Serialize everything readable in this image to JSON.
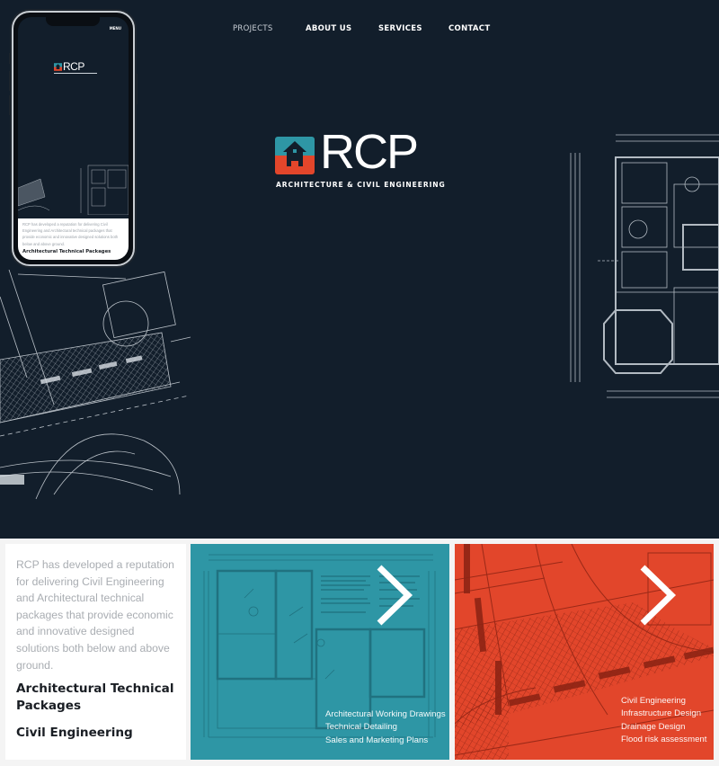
{
  "nav": {
    "items": [
      {
        "label": "PROJECTS",
        "active": true
      },
      {
        "label": "ABOUT US",
        "active": false
      },
      {
        "label": "SERVICES",
        "active": false
      },
      {
        "label": "CONTACT",
        "active": false
      }
    ]
  },
  "brand": {
    "name": "RCP",
    "tagline": "ARCHITECTURE & CIVIL ENGINEERING",
    "colors": {
      "navy": "#121e2b",
      "teal": "#2e96a5",
      "red": "#e2462b"
    },
    "logo_icon": "house-icon"
  },
  "phone_preview": {
    "menu_label": "MENU",
    "logo_text": "RCP",
    "intro": "RCP has developed a reputation for delivering Civil Engineering and Architectural technical packages that provide economic and innovative designed solutions both below and above ground.",
    "heading": "Architectural Technical Packages"
  },
  "intro": {
    "text": "RCP has developed a reputation for delivering Civil Engineering and Architectural technical packages that provide economic and innovative designed solutions both below and above ground.",
    "links": [
      "Architectural Technical Packages",
      "Civil Engineering"
    ]
  },
  "cards": [
    {
      "name": "architectural",
      "icon": "chevron-right-icon",
      "services": [
        "Architectural Working Drawings",
        "Technical Detailing",
        "Sales and Marketing Plans"
      ]
    },
    {
      "name": "civil",
      "icon": "chevron-right-icon",
      "services": [
        "Civil Engineering",
        "Infrastructure Design",
        "Drainage Design",
        "Flood risk assessment"
      ]
    }
  ]
}
